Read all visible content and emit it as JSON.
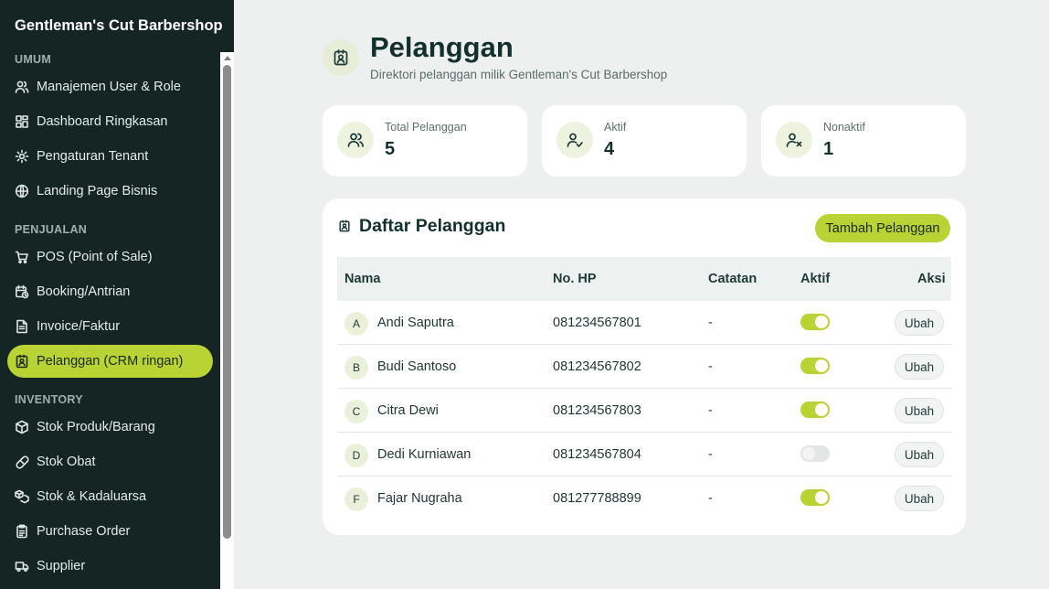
{
  "sidebar": {
    "brand": "Gentleman's Cut Barbershop",
    "sections": [
      {
        "label": "UMUM",
        "items": [
          {
            "label": "Manajemen User & Role",
            "icon": "users-icon"
          },
          {
            "label": "Dashboard Ringkasan",
            "icon": "dashboard-icon"
          },
          {
            "label": "Pengaturan Tenant",
            "icon": "gear-icon"
          },
          {
            "label": "Landing Page Bisnis",
            "icon": "globe-icon"
          }
        ]
      },
      {
        "label": "PENJUALAN",
        "items": [
          {
            "label": "POS (Point of Sale)",
            "icon": "cart-icon"
          },
          {
            "label": "Booking/Antrian",
            "icon": "calendar-clock-icon"
          },
          {
            "label": "Invoice/Faktur",
            "icon": "document-icon"
          },
          {
            "label": "Pelanggan (CRM ringan)",
            "icon": "contact-icon",
            "active": true
          }
        ]
      },
      {
        "label": "INVENTORY",
        "items": [
          {
            "label": "Stok Produk/Barang",
            "icon": "box-icon"
          },
          {
            "label": "Stok Obat",
            "icon": "pill-icon"
          },
          {
            "label": "Stok & Kadaluarsa",
            "icon": "boxes-icon"
          },
          {
            "label": "Purchase Order",
            "icon": "clipboard-icon"
          },
          {
            "label": "Supplier",
            "icon": "truck-icon"
          }
        ]
      }
    ]
  },
  "header": {
    "title": "Pelanggan",
    "subtitle": "Direktori pelanggan milik Gentleman's Cut Barbershop",
    "icon": "contact-icon"
  },
  "stats": [
    {
      "label": "Total Pelanggan",
      "value": "5",
      "icon": "users-icon"
    },
    {
      "label": "Aktif",
      "value": "4",
      "icon": "user-check-icon"
    },
    {
      "label": "Nonaktif",
      "value": "1",
      "icon": "user-x-icon"
    }
  ],
  "list": {
    "title": "Daftar Pelanggan",
    "add_label": "Tambah Pelanggan",
    "columns": [
      "Nama",
      "No. HP",
      "Catatan",
      "Aktif",
      "Aksi"
    ],
    "rows": [
      {
        "initial": "A",
        "name": "Andi Saputra",
        "phone": "081234567801",
        "note": "-",
        "active": true,
        "action": "Ubah"
      },
      {
        "initial": "B",
        "name": "Budi Santoso",
        "phone": "081234567802",
        "note": "-",
        "active": true,
        "action": "Ubah"
      },
      {
        "initial": "C",
        "name": "Citra Dewi",
        "phone": "081234567803",
        "note": "-",
        "active": true,
        "action": "Ubah"
      },
      {
        "initial": "D",
        "name": "Dedi Kurniawan",
        "phone": "081234567804",
        "note": "-",
        "active": false,
        "action": "Ubah"
      },
      {
        "initial": "F",
        "name": "Fajar Nugraha",
        "phone": "081277788899",
        "note": "-",
        "active": true,
        "action": "Ubah"
      }
    ]
  },
  "colors": {
    "accent": "#b9d234",
    "sidebar": "#152524",
    "background": "#eef0ef"
  }
}
